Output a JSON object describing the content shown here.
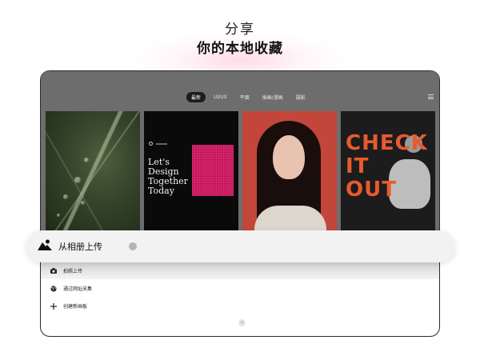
{
  "hero": {
    "title": "分享",
    "subtitle": "你的本地收藏"
  },
  "app": {
    "tabs": [
      {
        "label": "最新",
        "active": true
      },
      {
        "label": "UI/UX",
        "active": false
      },
      {
        "label": "平面",
        "active": false
      },
      {
        "label": "插画/漫画",
        "active": false
      },
      {
        "label": "摄影",
        "active": false
      }
    ],
    "menu_icon": "hamburger-menu-icon",
    "cards": [
      {
        "name": "leaf-photo",
        "alt": ""
      },
      {
        "name": "design-poster",
        "poster_text": "Let's\nDesign\nTogether\nToday"
      },
      {
        "name": "portrait-photo"
      },
      {
        "name": "check-it-out-poster",
        "poster_text": "CHECK\nIT\nOUT"
      }
    ]
  },
  "sheet": {
    "primary_action": {
      "label": "从相册上传",
      "icon": "image-mountain-icon"
    },
    "items": [
      {
        "label": "拍照上传",
        "icon": "camera-icon"
      },
      {
        "label": "通过网址采集",
        "icon": "globe-icon"
      },
      {
        "label": "创建新画板",
        "icon": "plus-icon"
      }
    ],
    "close_icon": "close-icon"
  },
  "colors": {
    "pink_block": "#d21a63",
    "check_orange": "#e65b2f",
    "portrait_bg": "#c2473a"
  }
}
